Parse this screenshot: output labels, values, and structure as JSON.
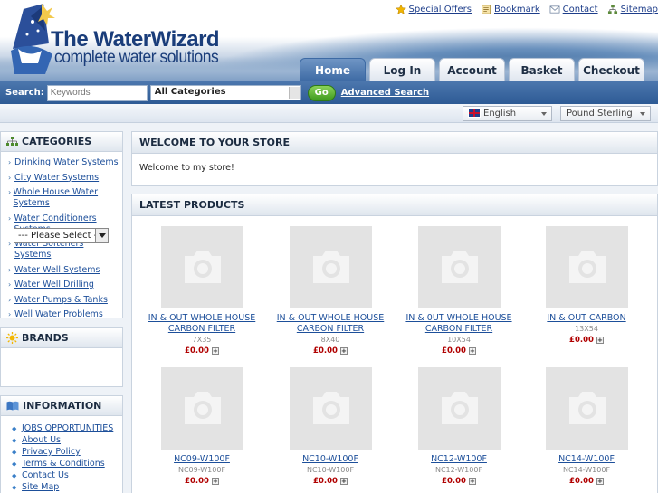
{
  "header": {
    "logo_title": "The WaterWizard",
    "logo_subtitle": "complete water solutions",
    "top_links": [
      {
        "label": "Special Offers",
        "icon": "star-icon"
      },
      {
        "label": "Bookmark",
        "icon": "bookmark-icon"
      },
      {
        "label": "Contact",
        "icon": "envelope-icon"
      },
      {
        "label": "Sitemap",
        "icon": "sitemap-icon"
      }
    ],
    "tabs": [
      {
        "label": "Home",
        "active": true
      },
      {
        "label": "Log In"
      },
      {
        "label": "Account"
      },
      {
        "label": "Basket"
      },
      {
        "label": "Checkout"
      }
    ]
  },
  "search": {
    "label": "Search:",
    "placeholder": "Keywords",
    "category_selected": "All Categories",
    "go_label": "Go",
    "advanced_label": "Advanced Search"
  },
  "locale": {
    "language": "English",
    "currency": "Pound Sterling"
  },
  "sidebar": {
    "categories_title": "CATEGORIES",
    "categories": [
      "Drinking Water Systems",
      "City Water Systems",
      "Whole House Water Systems",
      "Water Conditioners Systems",
      "Water Softeners Systems",
      "Water Well Systems",
      "Water Well Drilling",
      "Water Pumps & Tanks",
      "Well Water Problems"
    ],
    "brands_title": "BRANDS",
    "brands_select": "--- Please Select ---",
    "information_title": "INFORMATION",
    "information": [
      "JOBS OPPORTUNITIES",
      "About Us",
      "Privacy Policy",
      "Terms & Conditions",
      "Contact Us",
      "Site Map"
    ]
  },
  "main": {
    "welcome_title": "WELCOME TO YOUR STORE",
    "welcome_text": "Welcome to my store!",
    "latest_title": "LATEST PRODUCTS",
    "products": [
      {
        "name": "IN & OUT WHOLE HOUSE CARBON FILTER",
        "model": "7X35",
        "price": "£0.00"
      },
      {
        "name": "IN & OUT WHOLE HOUSE CARBON FILTER",
        "model": "8X40",
        "price": "£0.00"
      },
      {
        "name": "IN & 0UT WHOLE HOUSE CARBON FILTER",
        "model": "10X54",
        "price": "£0.00"
      },
      {
        "name": "IN & OUT CARBON",
        "model": "13X54",
        "price": "£0.00"
      },
      {
        "name": "NC09-W100F",
        "model": "NC09-W100F",
        "price": "£0.00"
      },
      {
        "name": "NC10-W100F",
        "model": "NC10-W100F",
        "price": "£0.00"
      },
      {
        "name": "NC12-W100F",
        "model": "NC12-W100F",
        "price": "£0.00"
      },
      {
        "name": "NC14-W100F",
        "model": "NC14-W100F",
        "price": "£0.00"
      }
    ]
  },
  "colors": {
    "nav_blue": "#2d5a95",
    "link_blue": "#1d4f9a",
    "price_red": "#b00000",
    "go_green": "#3e9a1e"
  }
}
